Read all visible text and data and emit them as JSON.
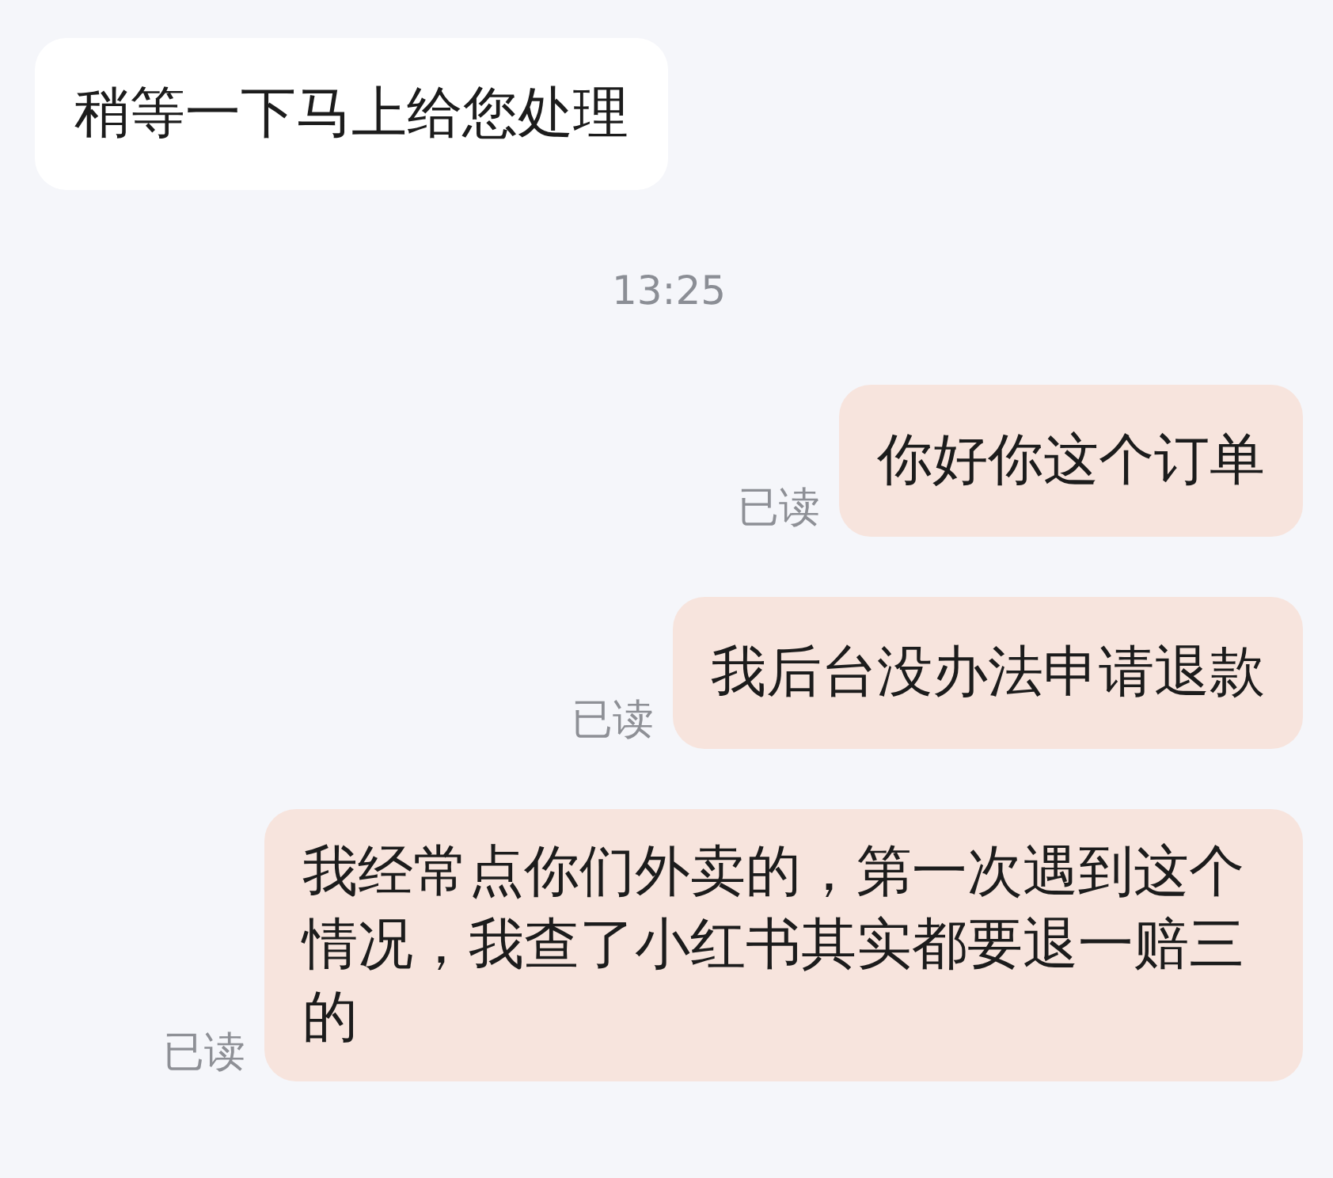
{
  "messages": [
    {
      "kind": "received",
      "text": "稍等一下马上给您处理"
    },
    {
      "kind": "timestamp",
      "text": "13:25"
    },
    {
      "kind": "sent",
      "text": "你好你这个订单",
      "status": "已读"
    },
    {
      "kind": "sent",
      "text": "我后台没办法申请退款",
      "status": "已读"
    },
    {
      "kind": "sent",
      "text": "我经常点你们外卖的，第一次遇到这个情况，我查了小红书其实都要退一赔三的",
      "status": "已读"
    }
  ]
}
